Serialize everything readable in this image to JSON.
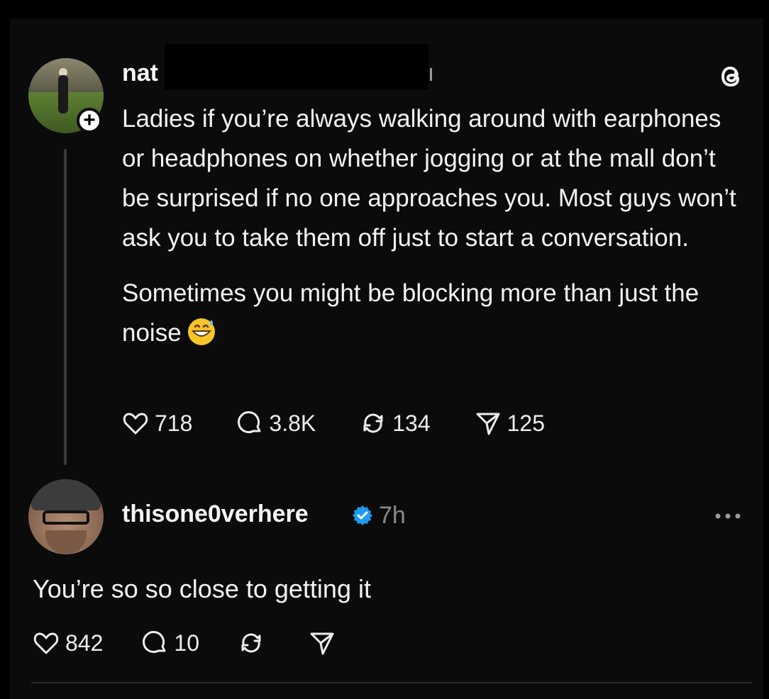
{
  "post": {
    "username": "nat",
    "text_paragraph_1": "Ladies if you’re always walking around with earphones or headphones on whether jogging or at the mall  don’t be surprised if no one approaches you. Most guys won’t ask you to take them off just to start a conversation.",
    "text_paragraph_2": "Sometimes you might be blocking more than just the noise",
    "emoji": "grinning-face-with-sweat",
    "likes": "718",
    "replies": "3.8K",
    "reposts": "134",
    "shares": "125"
  },
  "reply": {
    "username": "thisone0verhere",
    "time": "7h",
    "text": "You’re so so close to getting it",
    "likes": "842",
    "replies": "10"
  },
  "icons": {
    "like": "heart-icon",
    "reply": "comment-icon",
    "repost": "repost-icon",
    "share": "send-icon",
    "brand": "threads-logo-icon",
    "more": "more-icon",
    "verified": "verified-badge-icon"
  },
  "colors": {
    "background": "#0b0b0b",
    "text": "#f3f3f3",
    "muted": "#8a8a8a",
    "verified": "#1d9bf0"
  }
}
